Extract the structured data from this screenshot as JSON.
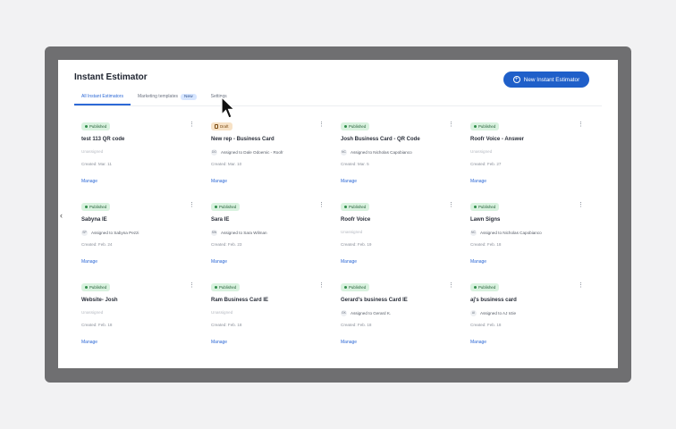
{
  "title": "Instant Estimator",
  "new_button_label": "New Instant Estimator",
  "tabs": {
    "all": "All Instant Estimators",
    "marketing": "Marketing templates",
    "marketing_badge": "New",
    "settings": "Settings"
  },
  "cards": [
    {
      "status": "Published",
      "name": "test 113 QR code",
      "assigned": "Unassigned",
      "created": "Created: Mar. 11",
      "manage": "Manage"
    },
    {
      "status": "Draft",
      "name": "New rep - Business Card",
      "assigned": "Assigned to Dale Odoemic - Roofr",
      "initials": "DO",
      "created": "Created: Mar. 10",
      "manage": "Manage"
    },
    {
      "status": "Published",
      "name": "Josh Business Card - QR Code",
      "assigned": "Assigned to Nicholas Capobianco",
      "initials": "NC",
      "created": "Created: Mar. 5",
      "manage": "Manage"
    },
    {
      "status": "Published",
      "name": "Roofr Voice - Answer",
      "assigned": "Unassigned",
      "created": "Created: Feb. 27",
      "manage": "Manage"
    },
    {
      "status": "Published",
      "name": "Sabyna IE",
      "assigned": "Assigned to Sabyna Pezzi",
      "initials": "SP",
      "created": "Created: Feb. 24",
      "manage": "Manage"
    },
    {
      "status": "Published",
      "name": "Sara IE",
      "assigned": "Assigned to Sara Wilman",
      "initials": "SW",
      "created": "Created: Feb. 23",
      "manage": "Manage"
    },
    {
      "status": "Published",
      "name": "Roofr Voice",
      "assigned": "Unassigned",
      "created": "Created: Feb. 19",
      "manage": "Manage"
    },
    {
      "status": "Published",
      "name": "Lawn Signs",
      "assigned": "Assigned to Nicholas Capobianco",
      "initials": "NC",
      "created": "Created: Feb. 18",
      "manage": "Manage"
    },
    {
      "status": "Published",
      "name": "Website- Josh",
      "assigned": "Unassigned",
      "created": "Created: Feb. 18",
      "manage": "Manage"
    },
    {
      "status": "Published",
      "name": "Ram Business Card IE",
      "assigned": "Unassigned",
      "created": "Created: Feb. 18",
      "manage": "Manage"
    },
    {
      "status": "Published",
      "name": "Gerard's business Card IE",
      "assigned": "Assigned to Gerard K.",
      "initials": "GK",
      "created": "Created: Feb. 18",
      "manage": "Manage"
    },
    {
      "status": "Published",
      "name": "aj's business card",
      "assigned": "Assigned to AJ Ictie",
      "initials": "AI",
      "created": "Created: Feb. 18",
      "manage": "Manage"
    }
  ],
  "colors": {
    "accent": "#1f5fc9",
    "published_bg": "#d9f2df",
    "draft_bg": "#f7e2c6"
  },
  "icons": {
    "new_button": "plus-circle-icon",
    "card_menu": "kebab-menu-icon",
    "draft": "document-icon",
    "collapse": "chevron-left-icon"
  }
}
